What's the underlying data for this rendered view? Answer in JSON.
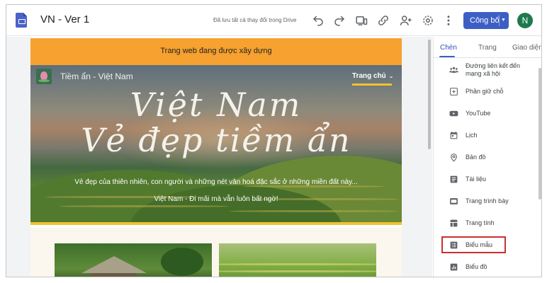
{
  "app": {
    "doc_title": "VN - Ver 1",
    "save_status": "Đã lưu tất cả thay đổi trong Drive",
    "publish_label": "Công bố",
    "avatar_initial": "N"
  },
  "toolbar": {
    "icons": [
      "undo-icon",
      "redo-icon",
      "preview-device-icon",
      "link-icon",
      "add-person-icon",
      "settings-icon",
      "more-vert-icon",
      "chevron-down-icon"
    ]
  },
  "site": {
    "banner_text": "Trang web đang được xây dựng",
    "name": "Tiềm ẩn - Việt Nam",
    "nav_home": "Trang chủ",
    "hero_title_line1": "Việt Nam",
    "hero_title_line2": "Vẻ đẹp tiềm ẩn",
    "hero_subtitle": "Vẻ đẹp của thiên nhiên, con người và những nét văn hoá đặc sắc ở những miền đất này...",
    "hero_slogan": "Việt Nam - Đi mãi mà vẫn luôn bất ngờ!"
  },
  "panel": {
    "tabs": [
      "Chèn",
      "Trang",
      "Giao diện"
    ],
    "active_tab": "Chèn",
    "items": [
      {
        "label": "Đường liên kết đến mạng xã hội",
        "icon": "social-links-icon"
      },
      {
        "label": "Phần giữ chỗ",
        "icon": "placeholder-icon"
      },
      {
        "label": "YouTube",
        "icon": "youtube-icon"
      },
      {
        "label": "Lịch",
        "icon": "calendar-icon"
      },
      {
        "label": "Bản đồ",
        "icon": "map-pin-icon"
      },
      {
        "label": "Tài liệu",
        "icon": "docs-icon"
      },
      {
        "label": "Trang trình bày",
        "icon": "slides-icon"
      },
      {
        "label": "Trang tính",
        "icon": "sheets-icon"
      },
      {
        "label": "Biểu mẫu",
        "icon": "forms-icon"
      },
      {
        "label": "Biểu đồ",
        "icon": "chart-icon"
      }
    ],
    "highlighted_item": "Biểu mẫu"
  },
  "colors": {
    "accent": "#3d5fc4",
    "banner": "#f6a130",
    "highlight_border": "#c8312f",
    "nav_underline": "#f2c230"
  }
}
